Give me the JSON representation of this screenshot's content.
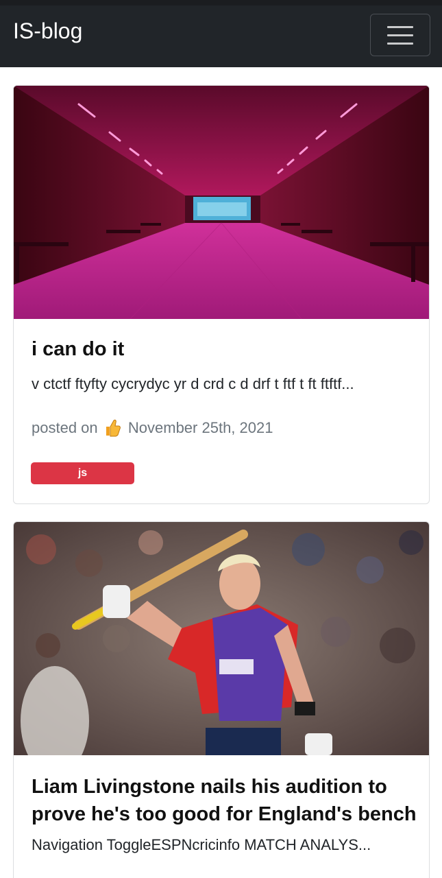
{
  "navbar": {
    "brand": "IS-blog",
    "toggle_icon": "hamburger-menu-icon"
  },
  "posts": [
    {
      "title": "i can do it",
      "excerpt": "v ctctf ftyfty cycrydyc yr d crd c d drf t ftf t ft ftftf...",
      "posted_label": "posted on",
      "posted_icon": "thumbs-up-icon",
      "date": "November 25th, 2021",
      "tag": "js",
      "tag_color": "#dc3545",
      "image": "pink-lit-tunnel-photo"
    },
    {
      "title": "Liam Livingstone nails his audition to prove he's too good for England's bench",
      "excerpt": "Navigation ToggleESPNcricinfo MATCH ANALYS...",
      "image": "cricketer-raising-bat-photo"
    }
  ]
}
